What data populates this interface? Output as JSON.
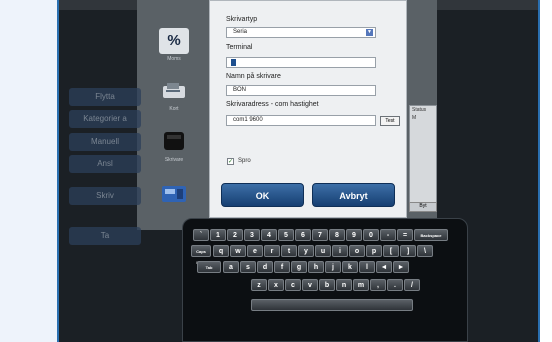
{
  "background_menu": [
    "Flytta",
    "Kategorier a",
    "Manuell",
    "Ansl",
    "Skriv",
    "Ta"
  ],
  "side_icons": [
    {
      "glyph": "%",
      "label": "Moms",
      "icon": "percent-icon"
    },
    {
      "glyph": "",
      "label": "Kort",
      "icon": "card-reader-icon"
    },
    {
      "glyph": "",
      "label": "Skrivare",
      "icon": "printer-icon"
    },
    {
      "glyph": "",
      "label": "",
      "icon": "cash-register-icon"
    }
  ],
  "background_list": {
    "header": "Status",
    "row": "M",
    "button": "Byt"
  },
  "dialog": {
    "printer_type_label": "Skrivartyp",
    "printer_type_value": "Seria",
    "terminal_label": "Terminal",
    "terminal_value": "",
    "printer_name_label": "Namn på skrivare",
    "printer_name_value": "BON",
    "printer_address_label": "Skrivaradress  - com hastighet",
    "printer_address_value": "com1 9600",
    "test_label": "Test",
    "checkbox_label": "Spro",
    "checkbox_checked": true,
    "ok_label": "OK",
    "cancel_label": "Avbryt"
  },
  "colors": {
    "accent": "#1d4f8f",
    "button": "#2a5d96",
    "border": "#2a6fb0"
  },
  "keyboard": {
    "row1": [
      "`",
      "1",
      "2",
      "3",
      "4",
      "5",
      "6",
      "7",
      "8",
      "9",
      "0",
      "-",
      "=",
      "Backspace"
    ],
    "row2": [
      "Caps Lock",
      "q",
      "w",
      "e",
      "r",
      "t",
      "y",
      "u",
      "i",
      "o",
      "p",
      "[",
      "]",
      "\\"
    ],
    "row3": [
      "Tab",
      "a",
      "s",
      "d",
      "f",
      "g",
      "h",
      "j",
      "k",
      "l",
      "◄",
      "►"
    ],
    "row4": [
      "z",
      "x",
      "c",
      "v",
      "b",
      "n",
      "m",
      ",",
      ".",
      "/"
    ],
    "space": ""
  }
}
